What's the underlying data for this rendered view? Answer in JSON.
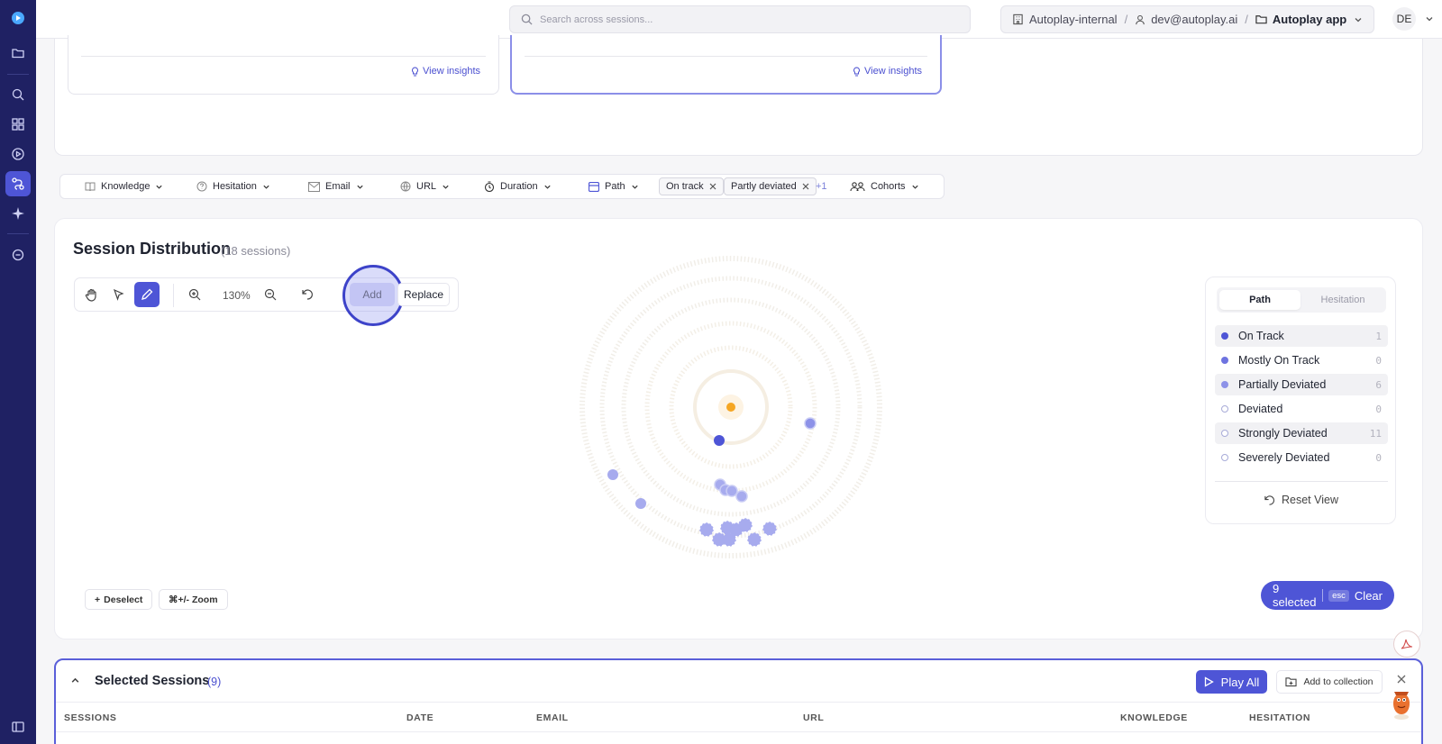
{
  "search": {
    "placeholder": "Search across sessions..."
  },
  "breadcrumb": {
    "org": "Autoplay-internal",
    "user": "dev@autoplay.ai",
    "app": "Autoplay app"
  },
  "user_initials": "DE",
  "insight_cards": [
    {
      "link": "View insights"
    },
    {
      "link": "View insights"
    }
  ],
  "filters": {
    "knowledge": "Knowledge",
    "hesitation": "Hesitation",
    "email": "Email",
    "url": "URL",
    "duration": "Duration",
    "path": "Path",
    "chips": [
      "On track",
      "Partly deviated"
    ],
    "more": "+1",
    "cohorts": "Cohorts"
  },
  "distribution": {
    "title": "Session Distribution",
    "count": "(18 sessions)",
    "zoom": "130%",
    "add_label": "Add",
    "replace_label": "Replace",
    "deselect_label": "Deselect",
    "zoom_hint": "⌘+/- Zoom",
    "selected_label": "9 selected",
    "esc_label": "esc",
    "clear_label": "Clear"
  },
  "legend": {
    "tabs": [
      "Path",
      "Hesitation"
    ],
    "items": [
      {
        "label": "On Track",
        "count": "1"
      },
      {
        "label": "Mostly On Track",
        "count": "0"
      },
      {
        "label": "Partially Deviated",
        "count": "6"
      },
      {
        "label": "Deviated",
        "count": "0"
      },
      {
        "label": "Strongly Deviated",
        "count": "11"
      },
      {
        "label": "Severely Deviated",
        "count": "0"
      }
    ],
    "reset_label": "Reset View"
  },
  "selected_sessions": {
    "title": "Selected Sessions",
    "count": "(9)",
    "play_all": "Play All",
    "add_to_collection": "Add to collection",
    "columns": [
      "SESSIONS",
      "DATE",
      "EMAIL",
      "URL",
      "KNOWLEDGE",
      "HESITATION"
    ]
  },
  "colors": {
    "accent": "#4e55d6",
    "rail": "#1f2163",
    "center": "#f5a623"
  }
}
